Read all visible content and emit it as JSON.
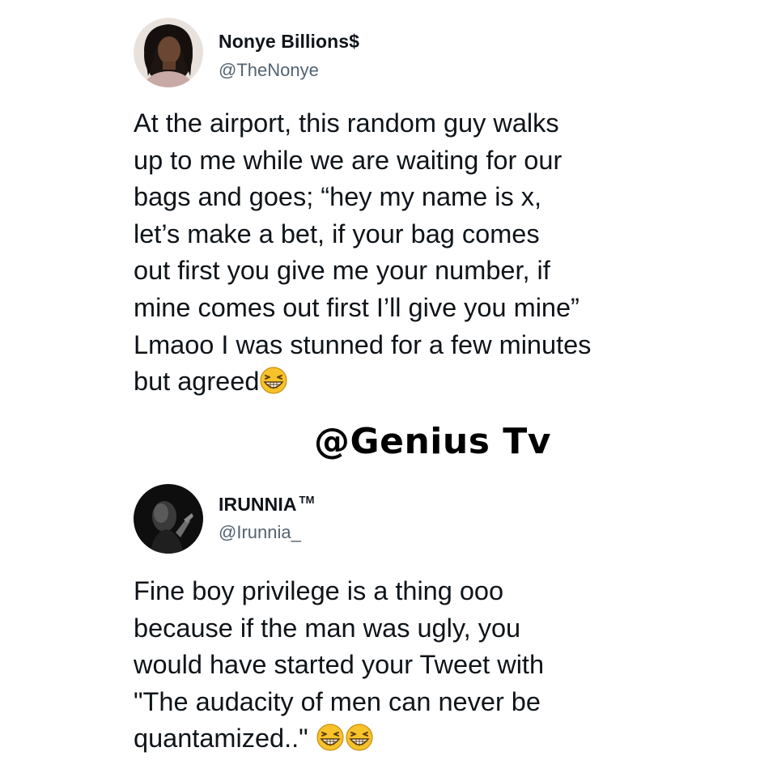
{
  "tweets": [
    {
      "display_name": "Nonye Billions$",
      "handle": "@TheNonye",
      "text": "At the airport, this random guy walks\nup to me while we are waiting for our\nbags and goes; “hey my name is x,\nlet’s make a bet, if your bag comes\nout first you give me your number, if\nmine comes out first I’ll give you mine”\nLmaoo I was stunned for a few minutes\nbut agreed",
      "trailing_emojis": [
        "grinning-squinting-face-emoji"
      ]
    },
    {
      "display_name": "IRUNNIA",
      "trademark": "TM",
      "handle": "@Irunnia_",
      "text": "Fine boy privilege is a thing ooo\nbecause if the man was ugly, you\nwould have started your Tweet with\n\"The audacity of men can never be\nquantamized..\" ",
      "trailing_emojis": [
        "grinning-squinting-face-emoji",
        "grinning-squinting-face-emoji"
      ]
    }
  ],
  "watermark": "@Genius Tv",
  "colors": {
    "text": "#0f1419",
    "secondary": "#536471",
    "emoji_face": "#f7c22a"
  }
}
